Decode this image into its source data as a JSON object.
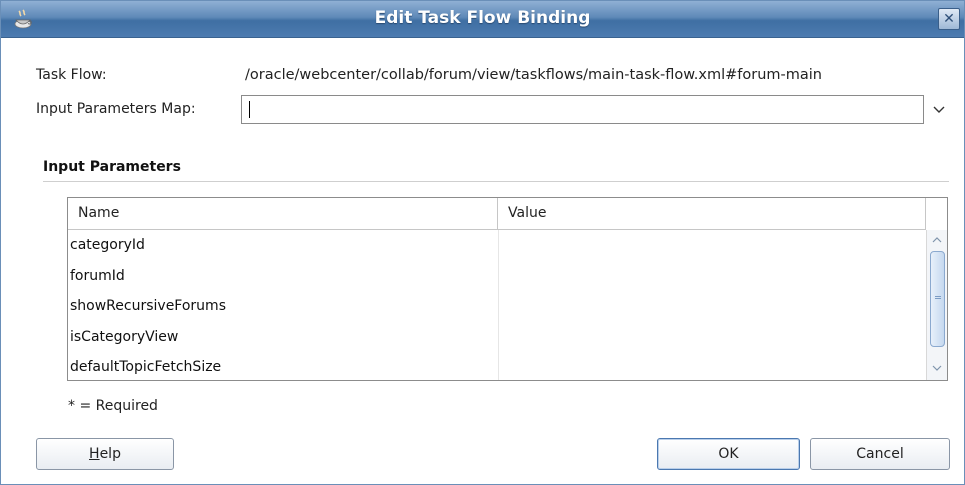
{
  "window": {
    "title": "Edit Task Flow Binding",
    "close_glyph": "✕",
    "icon": "coffee-cup-icon"
  },
  "form": {
    "task_flow_label": "Task Flow:",
    "task_flow_value": "/oracle/webcenter/collab/forum/view/taskflows/main-task-flow.xml#forum-main",
    "input_params_map_label": "Input Parameters Map:",
    "input_params_map_value": ""
  },
  "section": {
    "title": "Input Parameters"
  },
  "table": {
    "columns": [
      "Name",
      "Value"
    ],
    "rows": [
      {
        "name": "categoryId",
        "value": ""
      },
      {
        "name": "forumId",
        "value": ""
      },
      {
        "name": "showRecursiveForums",
        "value": ""
      },
      {
        "name": "isCategoryView",
        "value": ""
      },
      {
        "name": "defaultTopicFetchSize",
        "value": ""
      }
    ]
  },
  "note": {
    "required": "* = Required"
  },
  "buttons": {
    "help_mnemonic": "H",
    "help_rest": "elp",
    "ok": "OK",
    "cancel": "Cancel"
  },
  "colors": {
    "titlebar": "#4d7bb0",
    "accent_border": "#4b78b0"
  }
}
